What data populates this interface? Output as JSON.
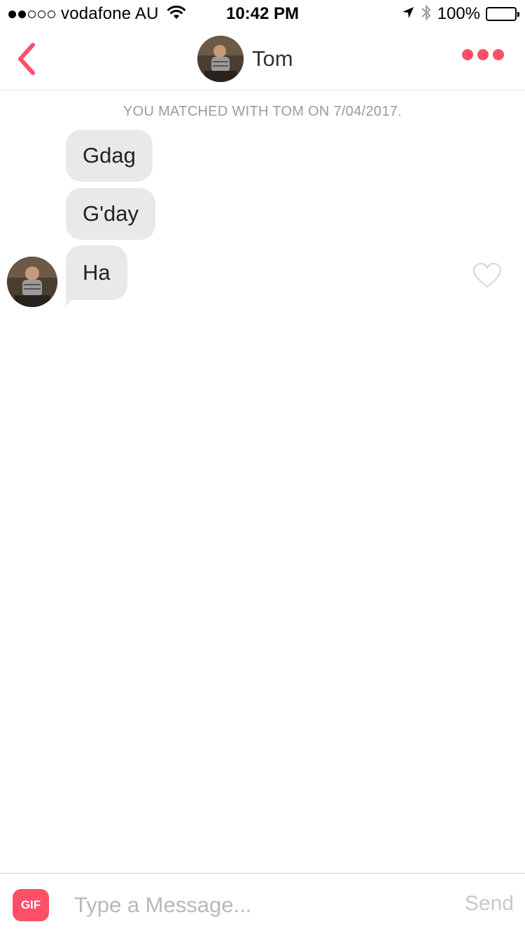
{
  "status_bar": {
    "carrier": "vodafone AU",
    "time": "10:42 PM",
    "battery_percent": "100%",
    "signal_bars_filled": 2,
    "signal_bars_total": 5,
    "icons": [
      "wifi-icon",
      "location-arrow-icon",
      "bluetooth-icon",
      "battery-icon"
    ]
  },
  "nav": {
    "back_icon": "chevron-left-icon",
    "name": "Tom",
    "more_icon": "more-dots-icon"
  },
  "chat": {
    "match_note": "YOU MATCHED WITH TOM ON 7/04/2017.",
    "messages": [
      {
        "text": "Gdag"
      },
      {
        "text": "G'day"
      },
      {
        "text": "Ha"
      }
    ],
    "like_icon": "heart-outline-icon"
  },
  "composer": {
    "gif_label": "GIF",
    "placeholder": "Type a Message...",
    "value": "",
    "send_label": "Send"
  },
  "colors": {
    "accent": "#fd5068",
    "bubble": "#e9e9eb",
    "muted_text": "#9b9b9b",
    "send_disabled": "#c8c8c8"
  }
}
